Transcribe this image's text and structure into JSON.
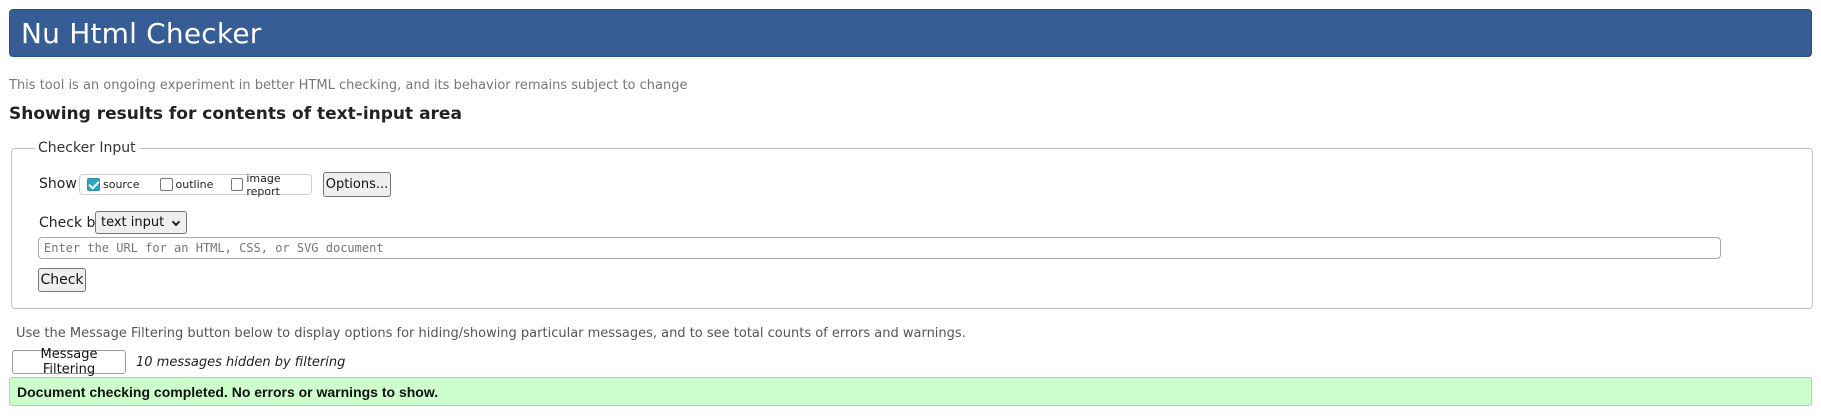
{
  "header": {
    "title": "Nu Html Checker"
  },
  "tagline": "This tool is an ongoing experiment in better HTML checking, and its behavior remains subject to change",
  "results_heading": "Showing results for contents of text-input area",
  "checker_input": {
    "legend": "Checker Input",
    "show_label": "Show",
    "show_options": [
      {
        "label": "source",
        "checked": true
      },
      {
        "label": "outline",
        "checked": false
      },
      {
        "label": "image report",
        "checked": false
      }
    ],
    "options_button": "Options...",
    "check_by_label": "Check by",
    "check_by_selected": "text input",
    "url_placeholder": "Enter the URL for an HTML, CSS, or SVG document",
    "check_button": "Check"
  },
  "filtering": {
    "note": "Use the Message Filtering button below to display options for hiding/showing particular messages, and to see total counts of errors and warnings.",
    "button": "Message Filtering",
    "hidden_count": "10 messages hidden by filtering"
  },
  "status": {
    "message": "Document checking completed. No errors or warnings to show."
  },
  "colors": {
    "header_bg": "#365d95",
    "success_bg": "#ccffcc",
    "checkbox_checked": "#30a5bf"
  }
}
